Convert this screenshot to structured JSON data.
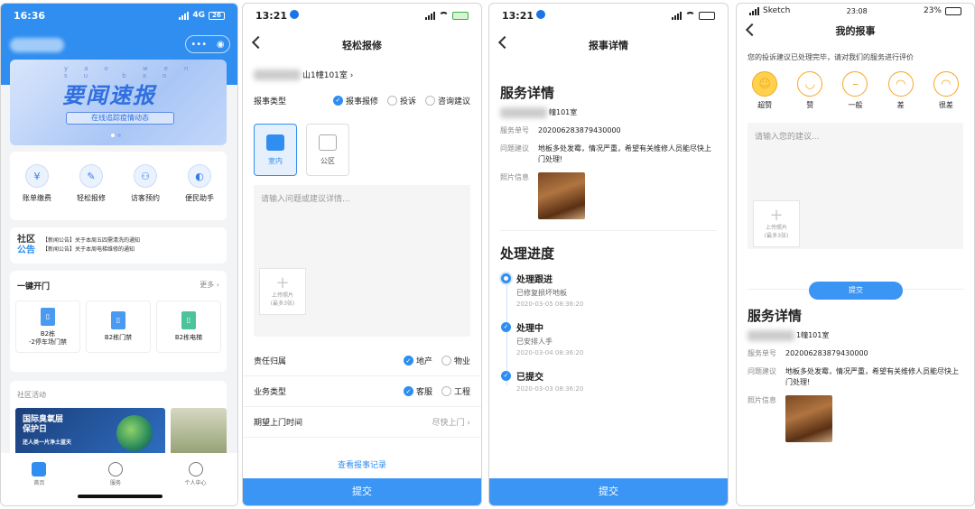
{
  "home": {
    "time": "16:36",
    "net": "4G",
    "battery": "26",
    "capsule_more": "•••",
    "banner_pinyin": "yao wen su bao",
    "banner_title": "要闻速报",
    "banner_sub": "在线追踪疫情动态",
    "grid": [
      {
        "label": "账单缴费",
        "icon": "¥"
      },
      {
        "label": "轻松报修",
        "icon": "✎"
      },
      {
        "label": "访客预约",
        "icon": "⚇"
      },
      {
        "label": "便民助手",
        "icon": "◐"
      }
    ],
    "notice_label1": "社区",
    "notice_label2": "公告",
    "notices": [
      "【新闻公告】关于本周五四需清洗的通知",
      "【新闻公告】关于本周电梯维修的通知"
    ],
    "quick_title": "一键开门",
    "quick_more": "更多 ›",
    "doors": [
      {
        "label": "B2栋\n-2停车场门禁",
        "icon": "▯"
      },
      {
        "label": "B2栋门禁",
        "icon": "▯"
      },
      {
        "label": "B2栋电梯",
        "icon": "▯"
      }
    ],
    "activity_title": "社区活动",
    "activity_img_title": "国际臭氧层\n保护日",
    "activity_img_sub": "还人类一片净土蓝天",
    "tabs": [
      {
        "label": "首页"
      },
      {
        "label": "服务"
      },
      {
        "label": "个人中心"
      }
    ]
  },
  "repair": {
    "time": "13:21",
    "title": "轻松报修",
    "address": "山1幢101室 ›",
    "type_label": "报事类型",
    "types": [
      {
        "label": "报事报修",
        "on": true
      },
      {
        "label": "投诉",
        "on": false
      },
      {
        "label": "咨询建议",
        "on": false
      }
    ],
    "locs": [
      {
        "label": "室内",
        "on": true
      },
      {
        "label": "公区",
        "on": false
      }
    ],
    "placeholder": "请输入问题或建议详情...",
    "upload": "上传照片",
    "upload_sub": "(最多3张)",
    "duty_label": "责任归属",
    "duty": [
      {
        "label": "地产",
        "on": true
      },
      {
        "label": "物业",
        "on": false
      }
    ],
    "biz_label": "业务类型",
    "biz": [
      {
        "label": "客服",
        "on": true
      },
      {
        "label": "工程",
        "on": false
      }
    ],
    "time_label": "期望上门时间",
    "time_value": "尽快上门 ›",
    "records": "查看报事记录",
    "submit": "提交"
  },
  "detail": {
    "time": "13:21",
    "title": "报事详情",
    "h1": "服务详情",
    "address": "幢101室",
    "no_label": "服务单号",
    "no_value": "20200628387943000​0",
    "issue_label": "问题建议",
    "issue_value": "地板多处发霉，情况严重，希望有关维修人员能尽快上门处理!",
    "photo_label": "照片信息",
    "h2": "处理进度",
    "steps": [
      {
        "title": "处理跟进",
        "desc": "已修复损坏地板",
        "time": "2020-03-05 08:36:20"
      },
      {
        "title": "处理中",
        "desc": "已安排人手",
        "time": "2020-03-04 08:36:20"
      },
      {
        "title": "已提交",
        "desc": "",
        "time": "2020-03-03 08:36:20"
      }
    ],
    "submit": "提交"
  },
  "mine": {
    "carrier": "Sketch",
    "time": "23:08",
    "battery": "23%",
    "title": "我的报事",
    "intro": "您的投诉建议已处理完毕，请对我们的服务进行评价",
    "faces": [
      {
        "label": "超赞",
        "glyph": "☺"
      },
      {
        "label": "赞",
        "glyph": "◡"
      },
      {
        "label": "一般",
        "glyph": "–"
      },
      {
        "label": "差",
        "glyph": "◠"
      },
      {
        "label": "很差",
        "glyph": "◠"
      }
    ],
    "placeholder": "请输入您的建议...",
    "upload": "上传照片",
    "upload_sub": "(最多3张)",
    "submit": "提交",
    "h1": "服务详情",
    "address": "1幢101室",
    "no_label": "服务单号",
    "no_value": "20200628387943000​0",
    "issue_label": "问题建议",
    "issue_value": "地板多处发霉，情况严重，希望有关维修人员能尽快上门处理!",
    "photo_label": "照片信息"
  },
  "colors": {
    "accent": "#2f8ef0",
    "face": "#f5a623"
  }
}
